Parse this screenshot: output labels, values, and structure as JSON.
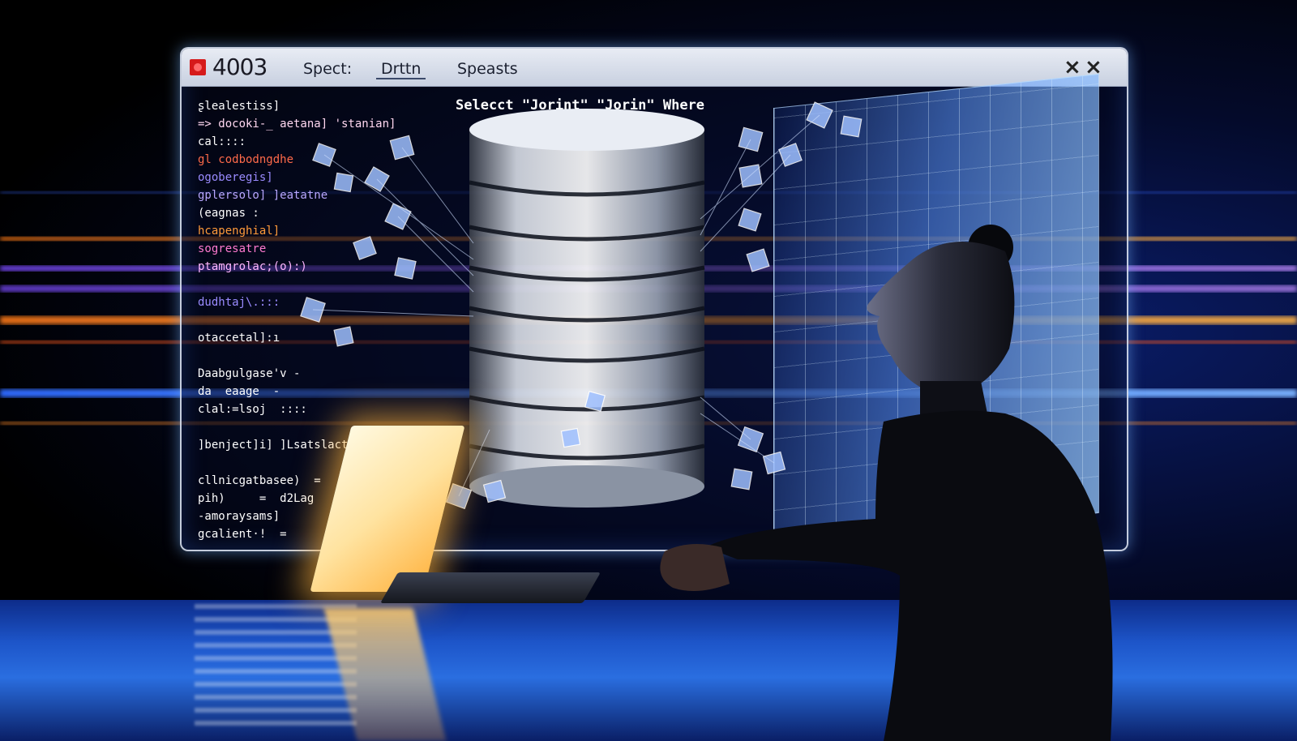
{
  "window": {
    "title": "4003",
    "menu": [
      "Spect:",
      "Drttn",
      "Speasts"
    ],
    "close_label_1": "×",
    "close_label_2": "×"
  },
  "query_text": "Selecct \"Jorint\" \"Jorin\" Where",
  "code_lines": [
    {
      "text": "ʂlealestiss]",
      "color": "#ffffff"
    },
    {
      "text": "=> docoki-_ aetana] 'stanian]",
      "color": "#ffd7f0"
    },
    {
      "text": "cal::::",
      "color": "#ffffff"
    },
    {
      "text": "gl codbodngdhe",
      "color": "#ff6a4a"
    },
    {
      "text": "ogoberegis]",
      "color": "#9a8bff"
    },
    {
      "text": "gplersolo] ]eatatne",
      "color": "#b9a7ff"
    },
    {
      "text": "(eagnas :",
      "color": "#ffffff"
    },
    {
      "text": "hcapenghial]",
      "color": "#ff9a3a"
    },
    {
      "text": "sogresatre",
      "color": "#ff7ad0"
    },
    {
      "text": "ptamgrolac;(o):)",
      "color": "#ffb6ff"
    },
    {
      "text": "",
      "color": "#ffffff"
    },
    {
      "text": "dudhtaj\\.:::",
      "color": "#9a8bff"
    },
    {
      "text": "",
      "color": "#ffffff"
    },
    {
      "text": "otaccetal]:ı",
      "color": "#ffffff"
    },
    {
      "text": "",
      "color": "#ffffff"
    },
    {
      "text": "Daabgulgase'v -",
      "color": "#ffffff"
    },
    {
      "text": "da  eaage  -",
      "color": "#ffffff"
    },
    {
      "text": "clal:=lsoj  ::::",
      "color": "#ffffff"
    },
    {
      "text": "",
      "color": "#ffffff"
    },
    {
      "text": "]benject]i] ]Lsatslacts[",
      "color": "#ffffff"
    },
    {
      "text": "",
      "color": "#ffffff"
    },
    {
      "text": "cllnicgatbasee)  =",
      "color": "#ffffff"
    },
    {
      "text": "pih)     =  d2Lag",
      "color": "#ffffff"
    },
    {
      "text": "-amoraysams]",
      "color": "#ffffff"
    },
    {
      "text": "gcalient·!  =",
      "color": "#ffffff"
    }
  ]
}
